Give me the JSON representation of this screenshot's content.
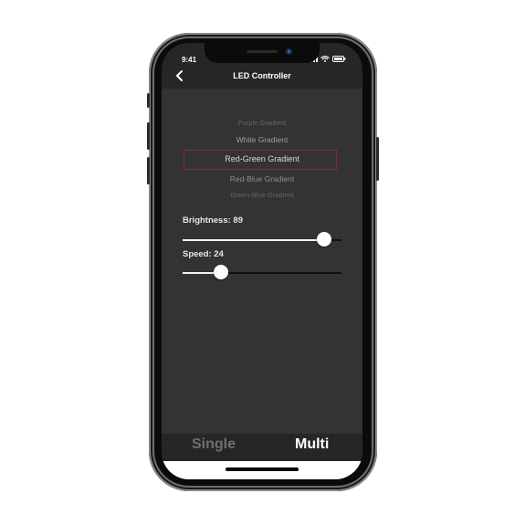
{
  "status": {
    "time": "9:41"
  },
  "nav": {
    "back_icon": "chevron-left-icon",
    "title": "LED Controller"
  },
  "picker": {
    "items": [
      "Purple Gradient",
      "White Gradient",
      "Red-Green Gradient",
      "Red-Blue Gradient",
      "Green-Blue Gradient"
    ],
    "selected_index": 2
  },
  "brightness": {
    "label": "Brightness: 89",
    "value": 89,
    "max": 100
  },
  "speed": {
    "label": "Speed: 24",
    "value": 24,
    "max": 100
  },
  "tabs": {
    "single": "Single",
    "multi": "Multi",
    "active": "multi"
  },
  "colors": {
    "screen_bg": "#333333",
    "bar_bg": "#262626",
    "selection_border": "#8b2a2a",
    "active_tab": "#ffffff",
    "inactive_tab": "#6f6f6f"
  }
}
